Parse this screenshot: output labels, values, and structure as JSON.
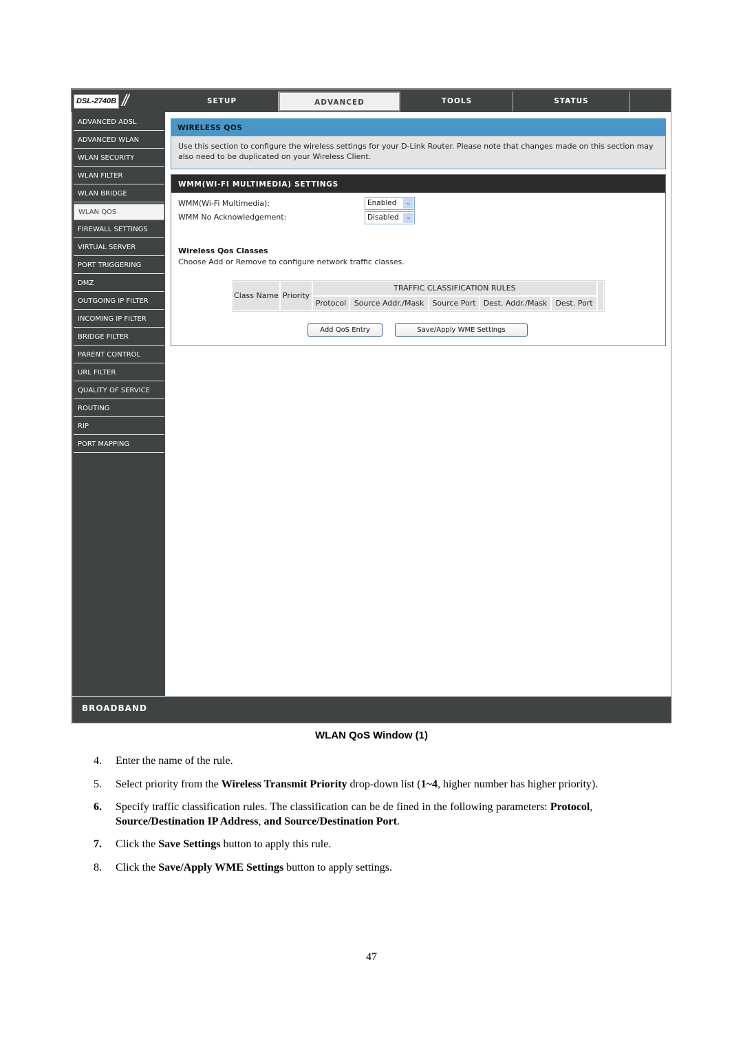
{
  "router": {
    "model": "DSL-2740B",
    "tabs": [
      {
        "label": "SETUP",
        "active": false
      },
      {
        "label": "ADVANCED",
        "active": true
      },
      {
        "label": "TOOLS",
        "active": false
      },
      {
        "label": "STATUS",
        "active": false
      }
    ],
    "sidebar": [
      {
        "label": "ADVANCED ADSL",
        "active": false
      },
      {
        "label": "ADVANCED WLAN",
        "active": false
      },
      {
        "label": "WLAN SECURITY",
        "active": false
      },
      {
        "label": "WLAN FILTER",
        "active": false
      },
      {
        "label": "WLAN BRIDGE",
        "active": false
      },
      {
        "label": "WLAN QOS",
        "active": true
      },
      {
        "label": "FIREWALL SETTINGS",
        "active": false
      },
      {
        "label": "VIRTUAL SERVER",
        "active": false
      },
      {
        "label": "PORT TRIGGERING",
        "active": false
      },
      {
        "label": "DMZ",
        "active": false
      },
      {
        "label": "OUTGOING IP FILTER",
        "active": false
      },
      {
        "label": "INCOMING IP FILTER",
        "active": false
      },
      {
        "label": "BRIDGE FILTER",
        "active": false
      },
      {
        "label": "PARENT CONTROL",
        "active": false
      },
      {
        "label": "URL FILTER",
        "active": false
      },
      {
        "label": "QUALITY OF SERVICE",
        "active": false
      },
      {
        "label": "ROUTING",
        "active": false
      },
      {
        "label": "RIP",
        "active": false
      },
      {
        "label": "PORT MAPPING",
        "active": false
      }
    ],
    "wireless_qos": {
      "title": "WIRELESS QOS",
      "description": "Use this section to configure the wireless settings for your D-Link Router. Please note that changes made on this section may also need to be duplicated on your Wireless Client."
    },
    "wmm": {
      "title": "WMM(WI-FI MULTIMEDIA) SETTINGS",
      "fields": [
        {
          "label": "WMM(Wi-Fi Multimedia):",
          "value": "Enabled"
        },
        {
          "label": "WMM No Acknowledgement:",
          "value": "Disabled"
        }
      ],
      "classes_title": "Wireless Qos Classes",
      "classes_text": "Choose Add or Remove to configure network traffic classes.",
      "table": {
        "col_class_name": "Class Name",
        "col_priority": "Priority",
        "group_header": "TRAFFIC CLASSIFICATION RULES",
        "sub_columns": [
          "Protocol",
          "Source Addr./Mask",
          "Source Port",
          "Dest. Addr./Mask",
          "Dest. Port"
        ]
      },
      "buttons": {
        "add": "Add QoS Entry",
        "save": "Save/Apply WME Settings"
      }
    },
    "footer_brand": "BROADBAND"
  },
  "document": {
    "caption": "WLAN QoS Window (1)",
    "steps": [
      {
        "num": "4.",
        "text": "Enter the name of the rule."
      },
      {
        "num": "5.",
        "pre": "Select priority from the ",
        "b1": "Wireless Transmit Priority",
        "mid": " drop-down list (",
        "b2": "1~4",
        "post": ", higher number has higher priority)."
      },
      {
        "num": "6.",
        "line1_pre": "Specify traffic classification rules. The classification can be de fined in the following parameters: ",
        "line1_b": "Protocol",
        "line1_post": ",",
        "line2_b1": "Source/Destination IP Address",
        "line2_mid": ", ",
        "line2_b2": "and Source/Destination Port",
        "line2_post": "."
      },
      {
        "num": "7.",
        "pre": "Click the ",
        "b1": "Save Settings",
        "post": " button to apply this rule."
      },
      {
        "num": "8.",
        "pre": "Click the ",
        "b1": "Save/Apply WME Settings",
        "post": " button to apply settings."
      }
    ],
    "page_number": "47"
  }
}
